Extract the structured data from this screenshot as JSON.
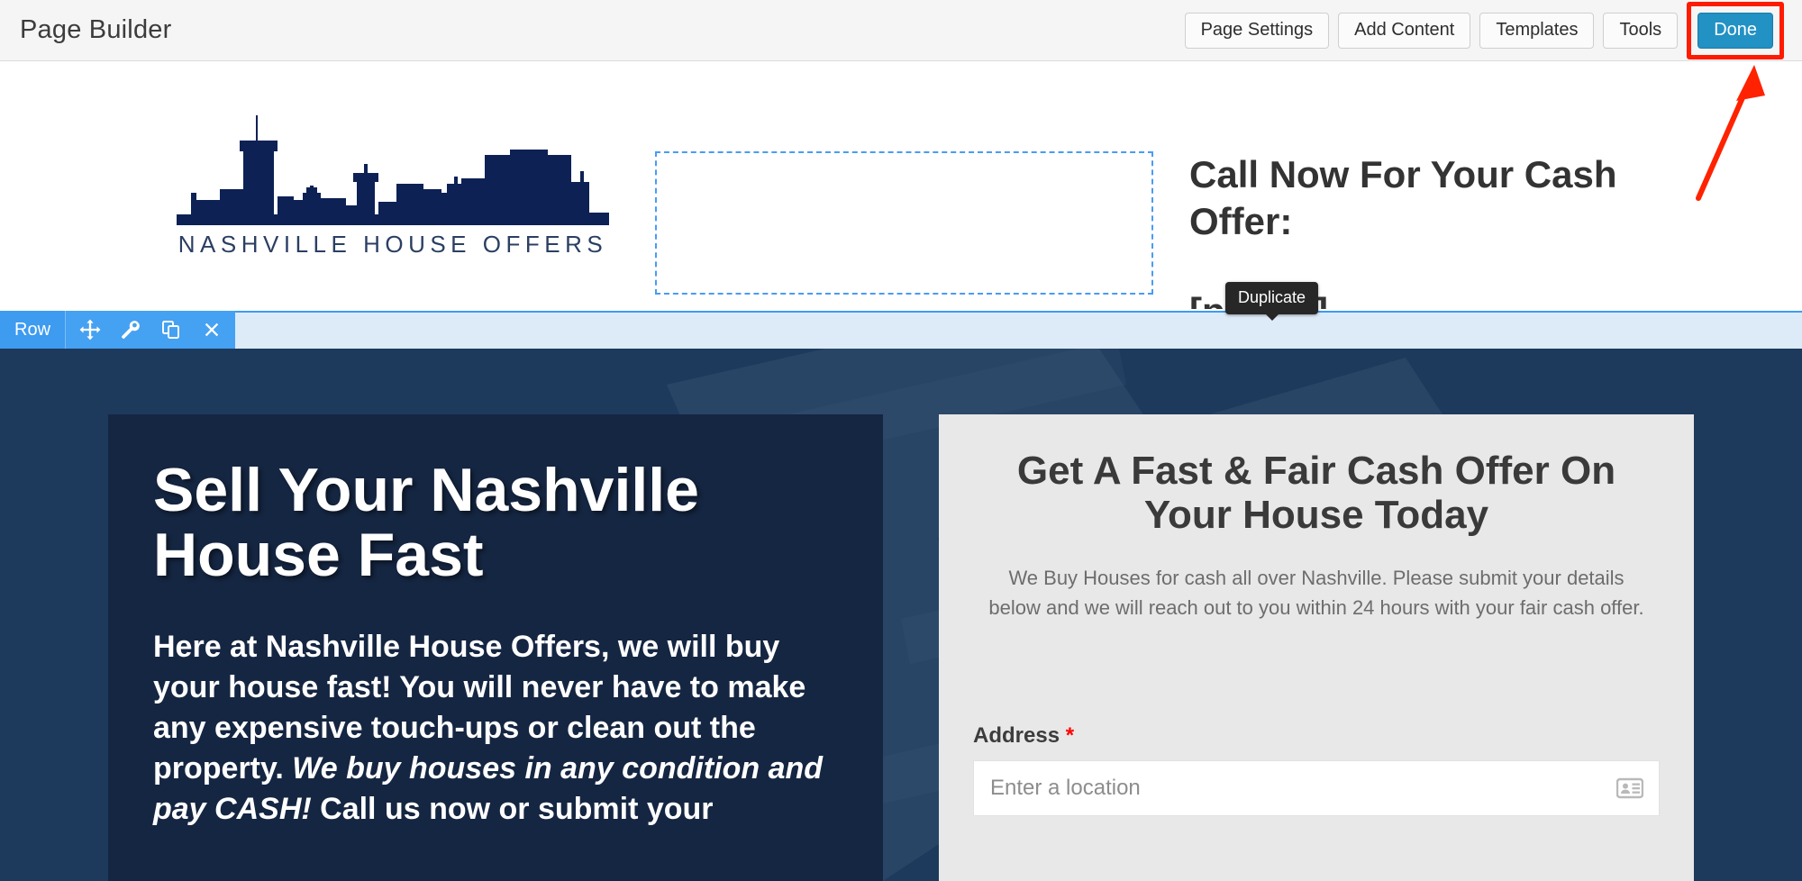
{
  "admin": {
    "title": "Page Builder",
    "buttons": [
      {
        "label": "Page Settings",
        "name": "page-settings-button"
      },
      {
        "label": "Add Content",
        "name": "add-content-button"
      },
      {
        "label": "Templates",
        "name": "templates-button"
      },
      {
        "label": "Tools",
        "name": "tools-button"
      }
    ],
    "done_label": "Done",
    "accent_color": "#2291c4",
    "highlight_color": "#ff1a00"
  },
  "tooltip": {
    "label": "Duplicate"
  },
  "row_toolbar": {
    "label": "Row",
    "tools": [
      {
        "name": "move-icon",
        "title": "Move"
      },
      {
        "name": "wrench-icon",
        "title": "Settings"
      },
      {
        "name": "duplicate-icon",
        "title": "Duplicate"
      },
      {
        "name": "close-icon",
        "title": "Remove"
      }
    ],
    "band_color": "#ddebf9",
    "tool_color": "#45a1f2"
  },
  "header": {
    "logo_text": "NASHVILLE HOUSE OFFERS",
    "logo_color": "#0d2155",
    "cta_heading": "Call Now For Your Cash Offer:",
    "cta_phone": "[phone]"
  },
  "hero": {
    "heading": "Sell Your Nashville House Fast",
    "paragraph_part1": "Here at Nashville House Offers, we will buy your house fast! You will never have to make any expensive touch-ups or clean out the property. ",
    "paragraph_emphasis": "We buy houses in any condition and pay CASH!",
    "paragraph_part2": " Call us now or submit your",
    "bg_color": "#1d3a5c",
    "panel_color": "#152642"
  },
  "form": {
    "title": "Get A Fast & Fair Cash Offer On Your House Today",
    "subtitle": "We Buy Houses for cash all over Nashville. Please submit your details below and we will reach out to you within 24 hours with your fair cash offer.",
    "address_label": "Address",
    "required_mark": "*",
    "address_placeholder": "Enter a location",
    "address_value": "",
    "address_icon": "contact-card-icon",
    "card_color": "#e8e8e8"
  }
}
